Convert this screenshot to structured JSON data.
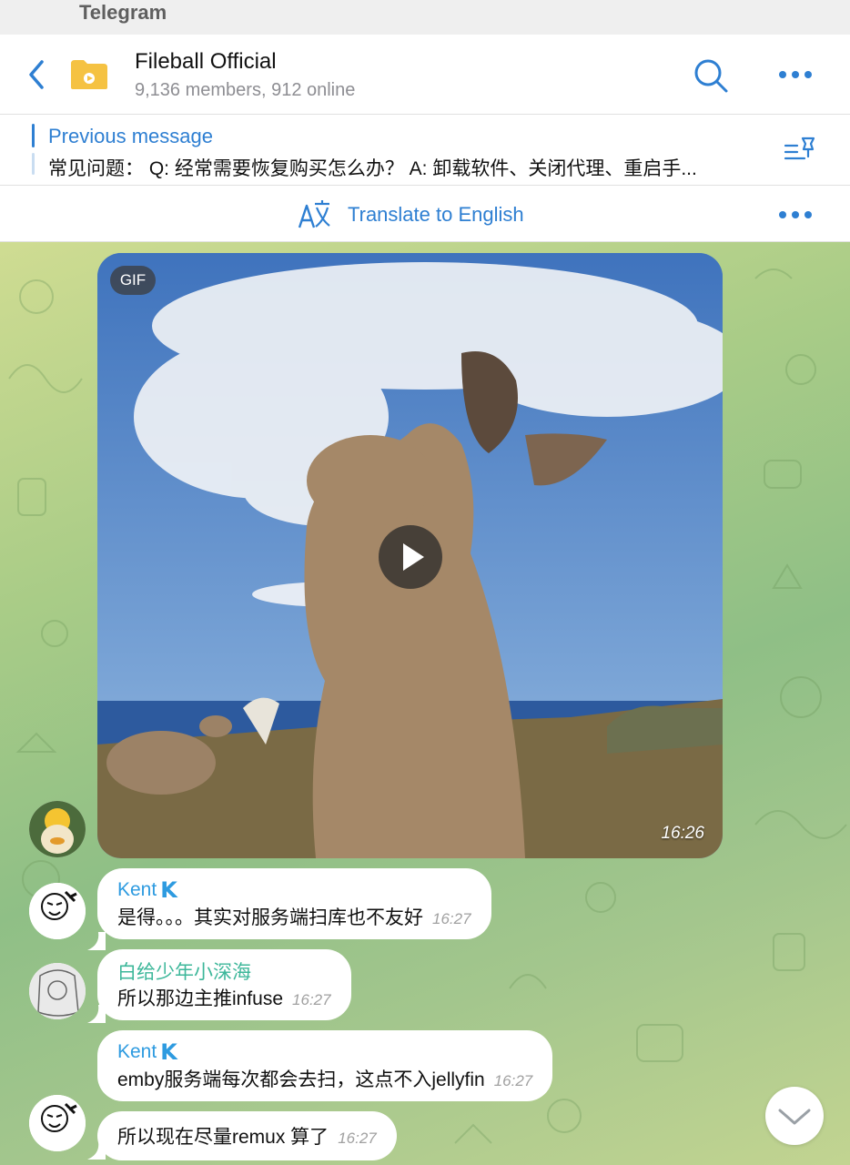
{
  "status_bar": {
    "app_name": "Telegram"
  },
  "header": {
    "title": "Fileball Official",
    "subtitle": "9,136 members, 912 online",
    "avatar_color": "#f5c242"
  },
  "pinned": {
    "title": "Previous message",
    "text": "常见问题： Q: 经常需要恢复购买怎么办？ A: 卸载软件、关闭代理、重启手..."
  },
  "translate": {
    "label": "Translate to English"
  },
  "colors": {
    "accent": "#2e7fd2",
    "sender_blue": "#2e9be0",
    "sender_green": "#3db79a"
  },
  "messages": [
    {
      "type": "gif",
      "badge": "GIF",
      "time": "16:26"
    },
    {
      "sender": "Kent",
      "verified_mark": "K",
      "text": "是得。。。其实对服务端扫库也不友好",
      "time": "16:27"
    },
    {
      "sender": "白给少年小深海",
      "text": "所以那边主推infuse",
      "time": "16:27"
    },
    {
      "sender": "Kent",
      "verified_mark": "K",
      "text": "emby服务端每次都会去扫，这点不入jellyfin",
      "time": "16:27"
    },
    {
      "text": "所以现在尽量remux 算了",
      "time": "16:27"
    }
  ]
}
